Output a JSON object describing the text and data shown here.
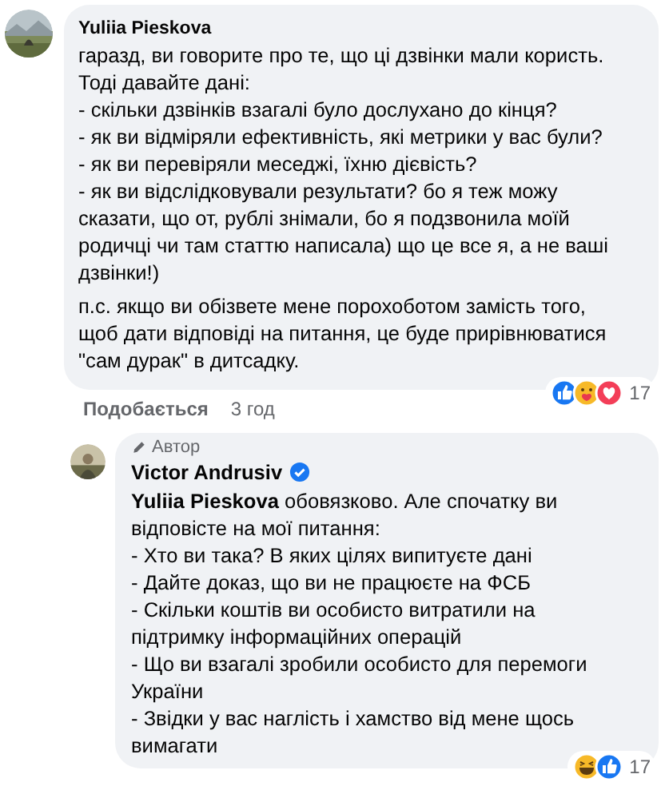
{
  "comments": [
    {
      "author": "Yuliia Pieskova",
      "verified": false,
      "paragraphs": [
        "гаразд, ви говорите про те, що ці дзвінки мали користь. Тоді давайте дані:\n- скільки дзвінків взагалі було дослухано до кінця?\n- як ви відміряли ефективність, які метрики у вас були?\n- як ви перевіряли меседжі, їхню дієвість?\n- як ви відслідковували результати? бо я теж можу сказати, що от, рублі знімали, бо я подзвонила моїй родичці чи там статтю написала) що це все я, а не ваші дзвінки!)",
        "п.с. якщо ви обізвете мене порохоботом замість того, щоб дати відповіді на питання, це буде прирівнюватися \"сам дурак\" в дитсадку."
      ],
      "reactions": [
        {
          "kind": "like"
        },
        {
          "kind": "care"
        },
        {
          "kind": "love"
        }
      ],
      "reaction_count": "17",
      "actions": [
        "Подобається",
        "3 год"
      ]
    },
    {
      "author": "Victor Andrusiv",
      "author_badge": "Автор",
      "verified": true,
      "mention": "Yuliia Pieskova",
      "paragraphs": [
        "обовязково. Але спочатку ви відповісте на мої питання:\n- Хто ви така? В яких цілях випитуєте дані\n- Дайте доказ, що ви не працюєте на ФСБ\n- Скільки коштів ви особисто витратили на підтримку інформаційних операцій\n- Що ви взагалі зробили особисто для перемоги України\n- Звідки у вас наглість і хамство від мене щось вимагати"
      ],
      "reactions": [
        {
          "kind": "haha"
        },
        {
          "kind": "like"
        }
      ],
      "reaction_count": "17"
    }
  ]
}
